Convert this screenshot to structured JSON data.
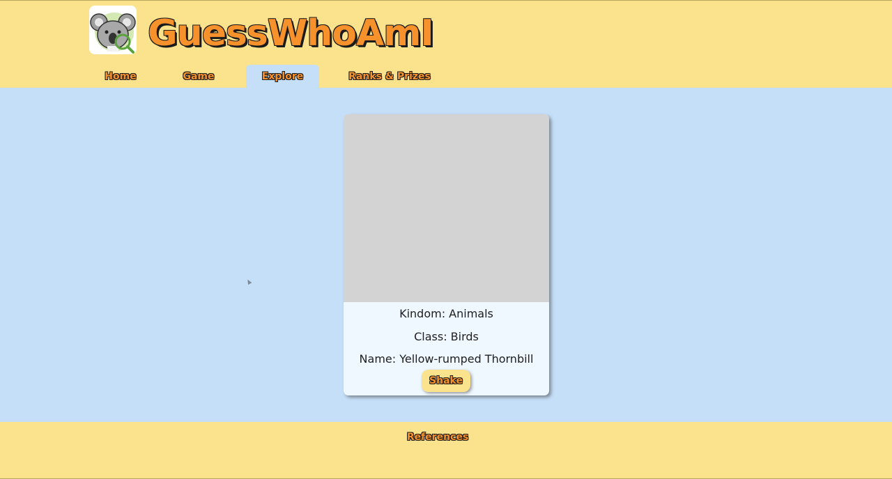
{
  "header": {
    "logo_icon": "koala-magnifier-icon",
    "title": "GuessWhoAmI"
  },
  "nav": {
    "items": [
      {
        "label": "Home",
        "active": false
      },
      {
        "label": "Game",
        "active": false
      },
      {
        "label": "Explore",
        "active": true
      },
      {
        "label": "Ranks & Prizes",
        "active": false
      }
    ]
  },
  "card": {
    "kingdom": "Kindom: Animals",
    "class": "Class: Birds",
    "name": "Name: Yellow-rumped Thornbill",
    "shake_label": "Shake"
  },
  "footer": {
    "references_label": "References"
  },
  "colors": {
    "header_bg": "#fae38c",
    "main_bg": "#c5dff8",
    "accent_orange": "#f7912c",
    "card_bg": "#eff7ff",
    "image_placeholder": "#d3d3d3"
  }
}
